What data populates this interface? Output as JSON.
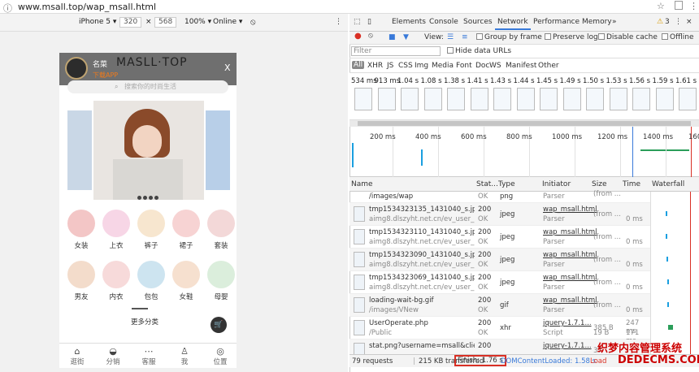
{
  "browser": {
    "url": "www.msall.top/wap_msall.html",
    "menu_icon": "star-icon"
  },
  "device": {
    "model": "iPhone 5 ▾",
    "width": "320",
    "x": "×",
    "height": "568",
    "zoom": "100% ▾",
    "network": "Online ▾"
  },
  "phone": {
    "title": "名菜",
    "subtitle": "下载APP",
    "brand": "MASLL·TOP",
    "close": "X",
    "search_placeholder": "搜索你的时尚生活",
    "categories": [
      {
        "label": "女装",
        "color": "#f3c6c6"
      },
      {
        "label": "上衣",
        "color": "#f7d6e6"
      },
      {
        "label": "裤子",
        "color": "#f7e6cf"
      },
      {
        "label": "裙子",
        "color": "#f7d3d3"
      },
      {
        "label": "套装",
        "color": "#f3d8d8"
      },
      {
        "label": "男友",
        "color": "#f3dccb"
      },
      {
        "label": "内衣",
        "color": "#f7dada"
      },
      {
        "label": "包包",
        "color": "#cde4f0"
      },
      {
        "label": "女鞋",
        "color": "#f6e0cf"
      },
      {
        "label": "母婴",
        "color": "#dbeedc"
      }
    ],
    "more": "更多分类",
    "nav": [
      {
        "label": "逛街",
        "icon": "home-icon"
      },
      {
        "label": "分销",
        "icon": "bag-icon"
      },
      {
        "label": "客服",
        "icon": "chat-icon"
      },
      {
        "label": "我",
        "icon": "user-icon"
      },
      {
        "label": "位置",
        "icon": "location-icon"
      }
    ]
  },
  "devtools": {
    "tabs": [
      "Elements",
      "Console",
      "Sources",
      "Network",
      "Performance",
      "Memory"
    ],
    "active_tab": "Network",
    "warnings": "3",
    "toolbar": {
      "view": "View:",
      "group": "Group by frame",
      "preserve": "Preserve log",
      "disable_cache": "Disable cache",
      "offline": "Offline"
    },
    "filter_placeholder": "Filter",
    "hide_data": "Hide data URLs",
    "types": [
      "All",
      "XHR",
      "JS",
      "CSS",
      "Img",
      "Media",
      "Font",
      "Doc",
      "WS",
      "Manifest",
      "Other"
    ],
    "film_times": [
      "534 ms",
      "913 ms",
      "1.04 s",
      "1.08 s",
      "1.38 s",
      "1.41 s",
      "1.43 s",
      "1.44 s",
      "1.45 s",
      "1.49 s",
      "1.50 s",
      "1.53 s",
      "1.56 s",
      "1.59 s",
      "1.61 s"
    ],
    "overview_ticks": [
      "200 ms",
      "400 ms",
      "600 ms",
      "800 ms",
      "1000 ms",
      "1200 ms",
      "1400 ms",
      "1600"
    ],
    "columns": [
      "Name",
      "Stat...",
      "Type",
      "Initiator",
      "Size",
      "Time",
      "Waterfall"
    ],
    "rows": [
      {
        "name": "/images/wap",
        "sub": "",
        "status": "",
        "sstat": "OK",
        "type": "png",
        "init": "",
        "isub": "Parser",
        "size": "(from ...",
        "time": "0 ms"
      },
      {
        "name": "tmp1534323135_1431040_s.jpg",
        "sub": "aimg8.dlszyht.net.cn/ev_user_mo...",
        "status": "200",
        "sstat": "OK",
        "type": "jpeg",
        "init": "wap_msall.html",
        "isub": "Parser",
        "size": "(from ...",
        "time": "0 ms"
      },
      {
        "name": "tmp1534323110_1431040_s.jpg",
        "sub": "aimg8.dlszyht.net.cn/ev_user_mo...",
        "status": "200",
        "sstat": "OK",
        "type": "jpeg",
        "init": "wap_msall.html",
        "isub": "Parser",
        "size": "(from ...",
        "time": "0 ms"
      },
      {
        "name": "tmp1534323090_1431040_s.jpg",
        "sub": "aimg8.dlszyht.net.cn/ev_user_mo...",
        "status": "200",
        "sstat": "OK",
        "type": "jpeg",
        "init": "wap_msall.html",
        "isub": "Parser",
        "size": "(from ...",
        "time": "0 ms"
      },
      {
        "name": "tmp1534323069_1431040_s.jpg",
        "sub": "aimg8.dlszyht.net.cn/ev_user_mo...",
        "status": "200",
        "sstat": "OK",
        "type": "jpeg",
        "init": "wap_msall.html",
        "isub": "Parser",
        "size": "(from ...",
        "time": "0 ms"
      },
      {
        "name": "loading-wait-bg.gif",
        "sub": "/images/VNew",
        "status": "200",
        "sstat": "OK",
        "type": "gif",
        "init": "wap_msall.html",
        "isub": "Parser",
        "size": "(from ...",
        "time": "0 ms"
      },
      {
        "name": "UserOperate.php",
        "sub": "/Public",
        "status": "200",
        "sstat": "OK",
        "type": "xhr",
        "init": "jquery-1.7.1...",
        "isub": "Script",
        "size": "385 B",
        "ssub": "19 B",
        "time": "247 ms",
        "tsub": "171 ms"
      },
      {
        "name": "stat.png?username=msall&client...",
        "sub": "",
        "status": "200",
        "sstat": "",
        "type": "",
        "init": "jquery-1.7.1...",
        "isub": "",
        "size": "37",
        "time": ""
      }
    ],
    "status": {
      "requests": "79 requests",
      "transferred": "215 KB transferred",
      "finish": "Finish: 1.76 s",
      "dcl": "DOMContentLoaded: 1.58 s",
      "load": "Load"
    },
    "watermark": "织梦内容管理系统",
    "watermark2": "DEDECMS.COM"
  }
}
